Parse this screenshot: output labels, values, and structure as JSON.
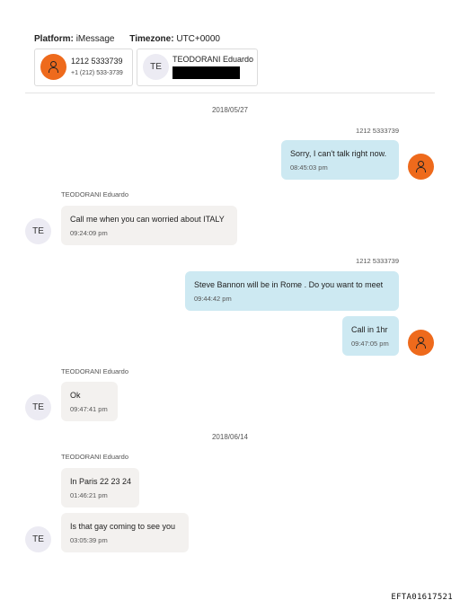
{
  "header": {
    "platform_label": "Platform:",
    "platform_value": "iMessage",
    "timezone_label": "Timezone:",
    "timezone_value": "UTC+0000"
  },
  "participants": [
    {
      "number": "1212 5333739",
      "sub": "+1 (212) 533-3739",
      "avatar_icon": "person-icon"
    },
    {
      "initials": "TE",
      "name": "TEODORANI Eduardo",
      "redacted": true
    }
  ],
  "dates": [
    "2018/05/27",
    "2018/06/14"
  ],
  "messages": [
    {
      "sender": "1212 5333739",
      "text": "Sorry, I can't talk right now.",
      "time": "08:45:03 pm"
    },
    {
      "sender": "TEODORANI Eduardo",
      "text": "Call me when you can worried about ITALY",
      "time": "09:24:09 pm"
    },
    {
      "sender": "1212 5333739",
      "text": "Steve Bannon will be in Rome .  Do you want to meet",
      "time": "09:44:42 pm"
    },
    {
      "text": "Call in 1hr",
      "time": "09:47:05 pm"
    },
    {
      "sender": "TEODORANI Eduardo",
      "text": "Ok",
      "time": "09:47:41 pm"
    },
    {
      "sender": "TEODORANI Eduardo",
      "text": "In Paris 22 23 24",
      "time": "01:46:21 pm"
    },
    {
      "text": "Is that gay coming to see you",
      "time": "03:05:39 pm"
    }
  ],
  "avatar_initials": "TE",
  "footer": "EFTA01617521",
  "colors": {
    "outgoing_bubble": "#cde9f2",
    "incoming_bubble": "#f3f1ef",
    "avatar_orange": "#ee6a1c",
    "avatar_te": "#ecebf3"
  }
}
